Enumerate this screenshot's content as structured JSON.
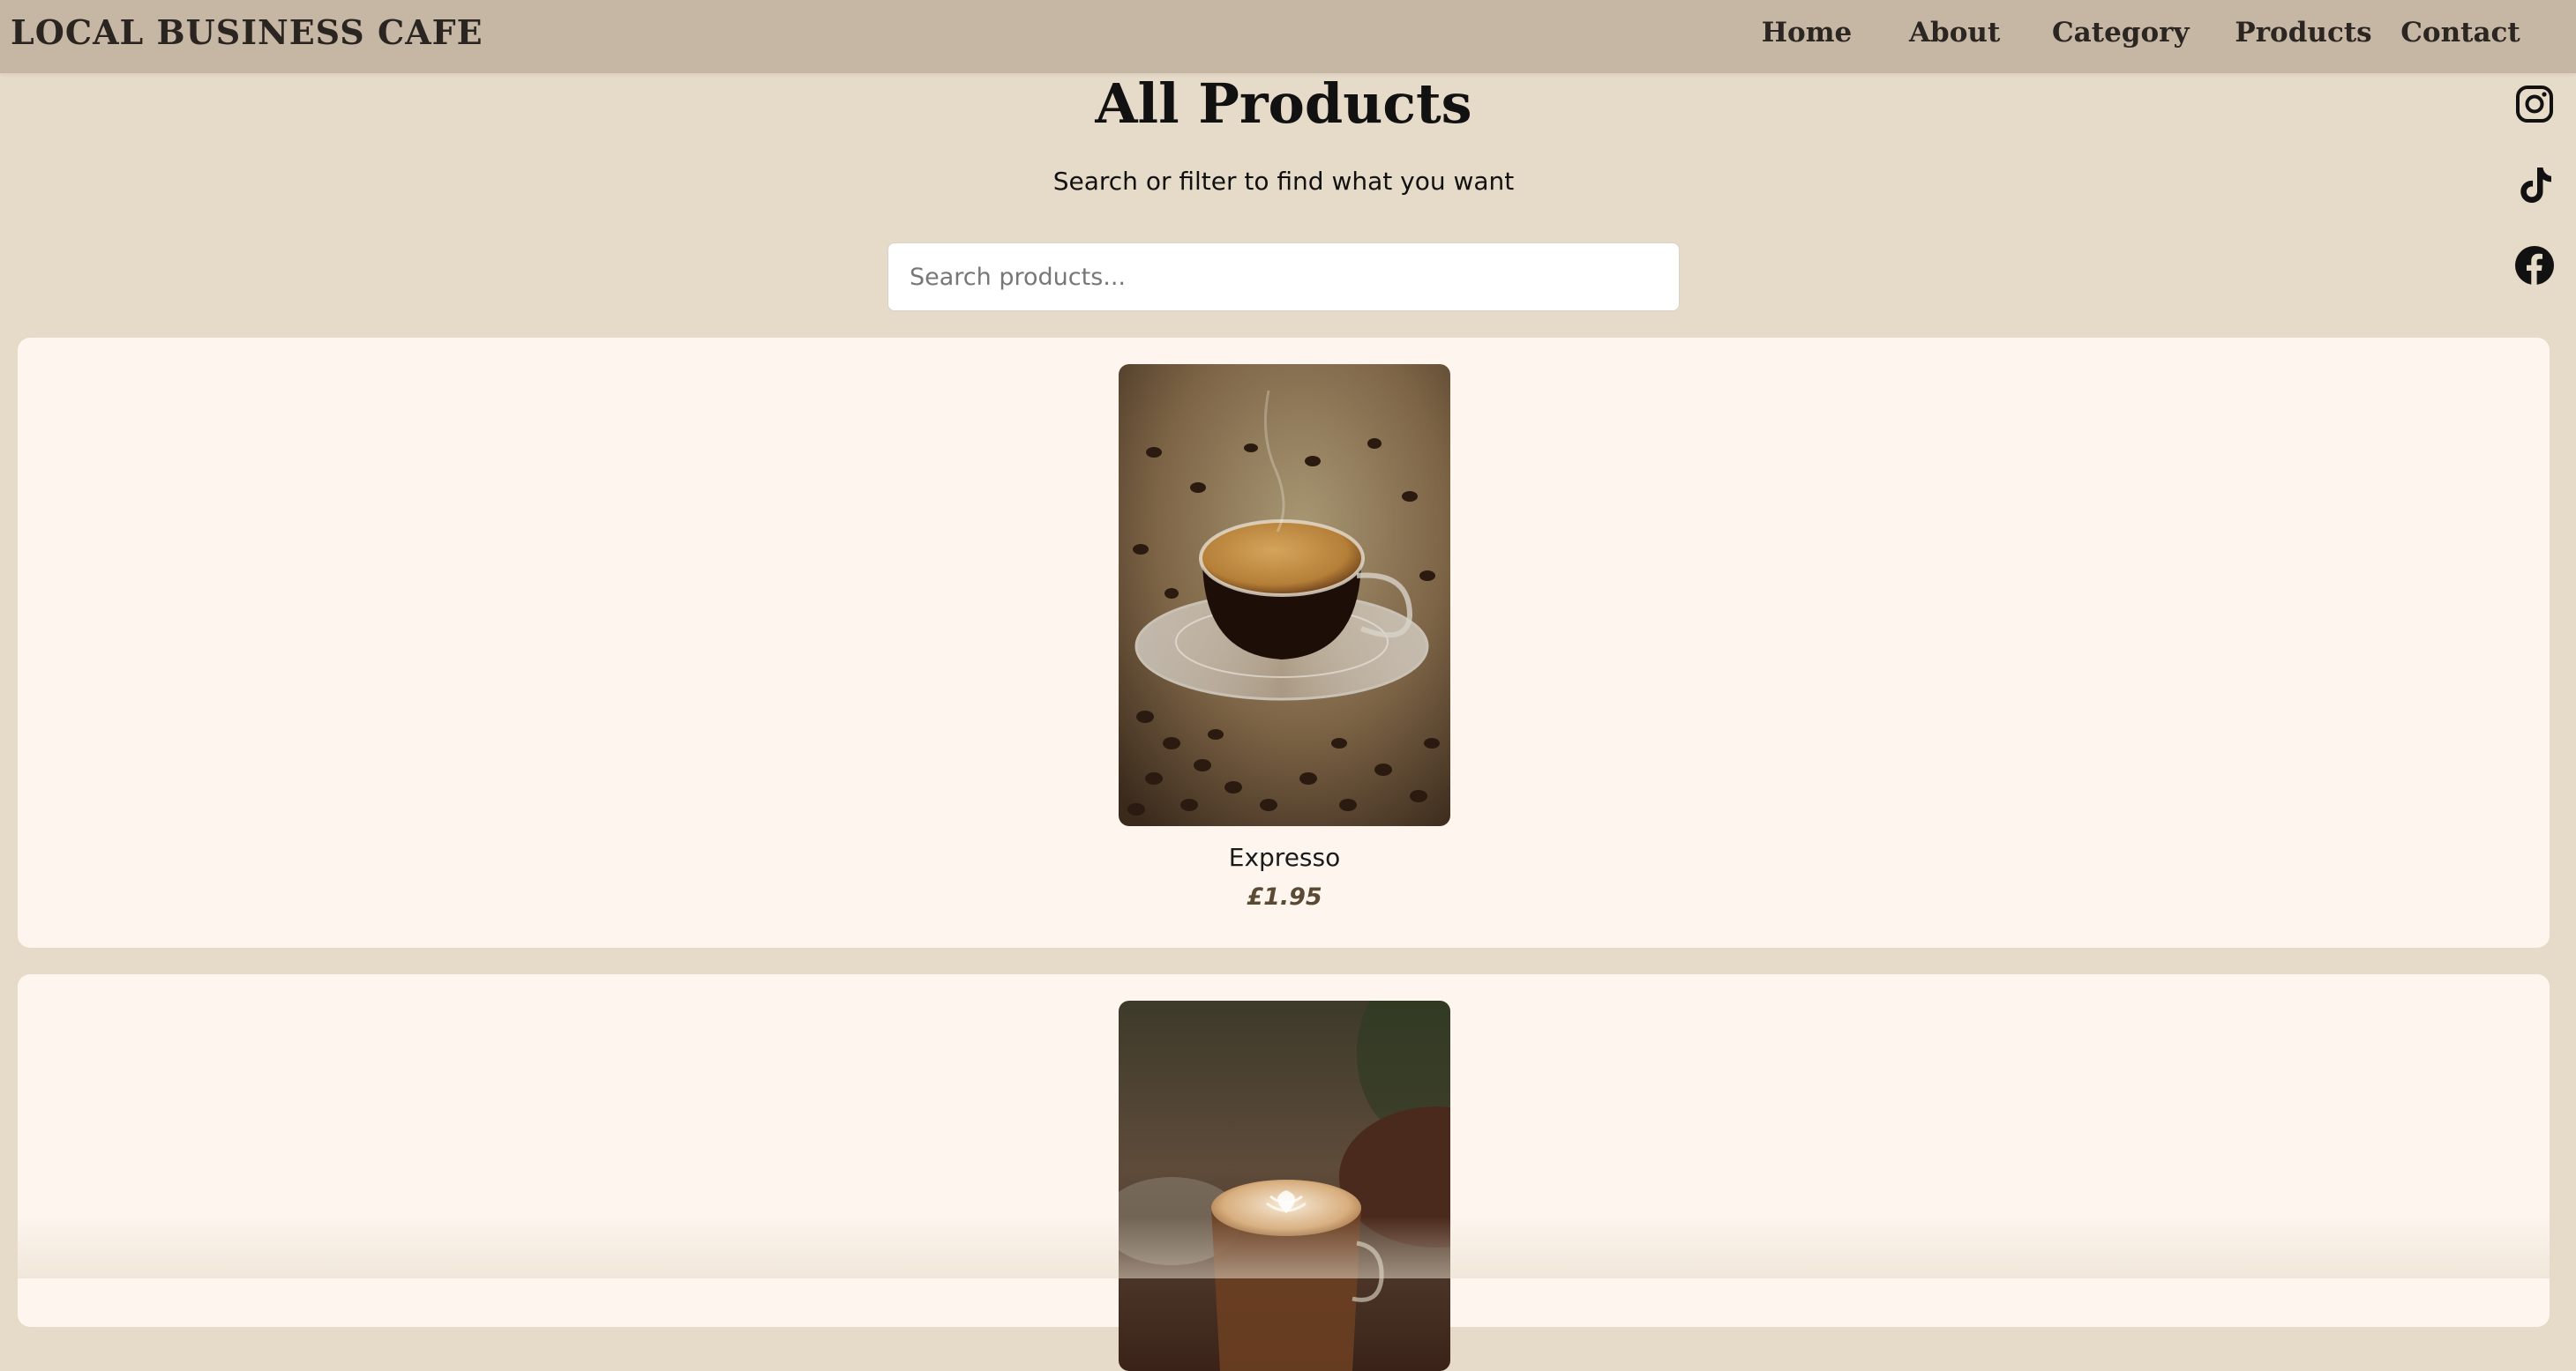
{
  "navbar": {
    "brand": "LOCAL BUSINESS CAFE",
    "items": [
      {
        "label": "Home"
      },
      {
        "label": "About"
      },
      {
        "label": "Category"
      },
      {
        "label": "Products"
      },
      {
        "label": "Contact"
      }
    ]
  },
  "header": {
    "title": "All Products",
    "subtitle": "Search or filter to find what you want"
  },
  "search": {
    "placeholder": "Search products...",
    "value": ""
  },
  "social": {
    "icons": [
      "instagram-icon",
      "tiktok-icon",
      "facebook-icon"
    ]
  },
  "products": [
    {
      "name": "Expresso",
      "price": "£1.95",
      "image": "espresso-cup-with-coffee-beans"
    },
    {
      "name": "",
      "price": "",
      "image": "latte-art-glass-cup"
    }
  ],
  "colors": {
    "page_background": "#e6dac8",
    "navbar_background": "#c6b7a4",
    "card_background": "#fdf5ee",
    "price_text": "#5b4a33"
  }
}
